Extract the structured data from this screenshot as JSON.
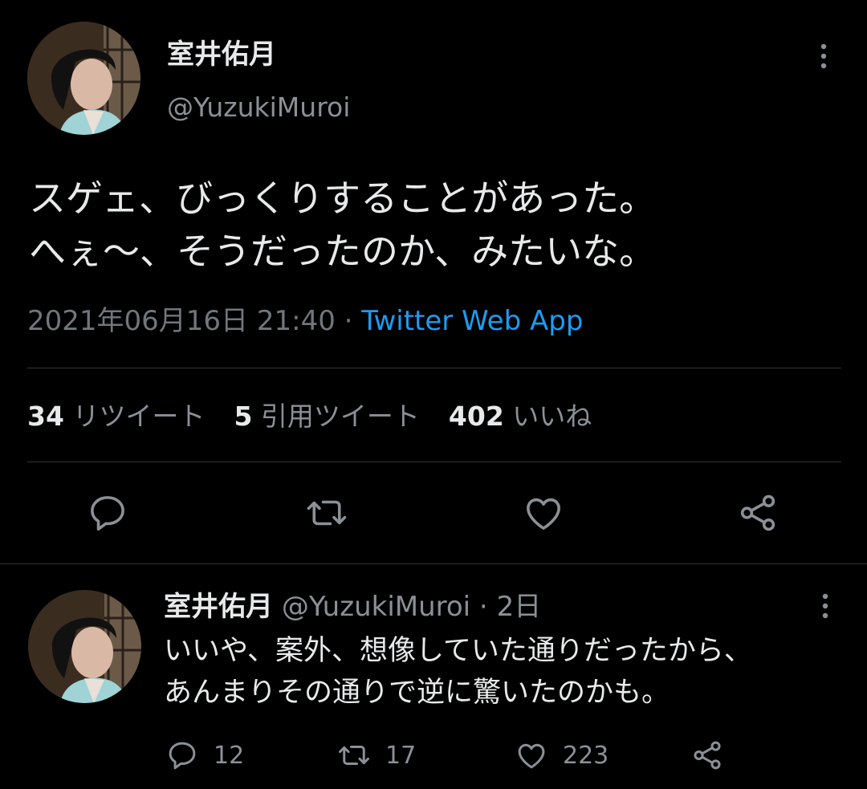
{
  "main_tweet": {
    "author_name": "室井佑月",
    "author_handle": "@YuzukiMuroi",
    "text_lines": [
      "スゲェ、びっくりすることがあった。",
      "へぇ〜、そうだったのか、みたいな。"
    ],
    "datetime": "2021年06月16日 21:40",
    "separator": " · ",
    "source": "Twitter Web App",
    "stats": {
      "retweets_count": "34",
      "retweets_label": "リツイート",
      "quotes_count": "5",
      "quotes_label": "引用ツイート",
      "likes_count": "402",
      "likes_label": "いいね"
    },
    "actions": [
      "reply-icon",
      "retweet-icon",
      "like-icon",
      "share-icon"
    ]
  },
  "reply": {
    "author_name": "室井佑月",
    "author_handle": "@YuzukiMuroi",
    "separator": " · ",
    "time": "2日",
    "text_lines": [
      "いいや、案外、想像していた通りだったから、",
      "あんまりその通りで逆に驚いたのかも。"
    ],
    "reply_count": "12",
    "retweet_count": "17",
    "like_count": "223"
  },
  "colors": {
    "background": "#000000",
    "text": "#e7e9ea",
    "secondary": "#71767b",
    "accent": "#1d9bf0",
    "divider": "#2f3336"
  }
}
